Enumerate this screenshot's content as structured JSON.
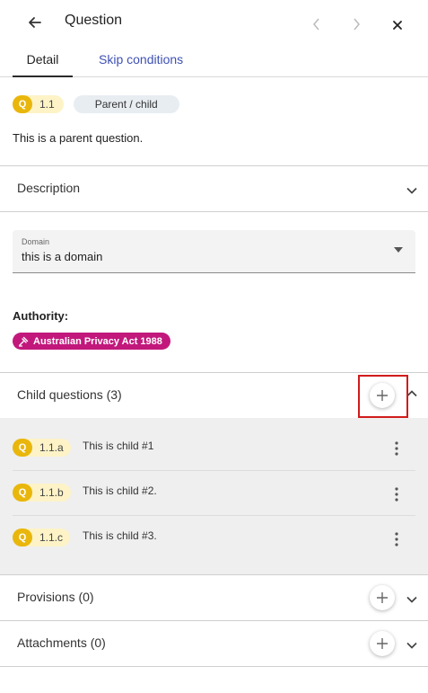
{
  "header": {
    "title": "Question"
  },
  "tabs": [
    {
      "label": "Detail"
    },
    {
      "label": "Skip conditions"
    }
  ],
  "question": {
    "badge_letter": "Q",
    "number": "1.1",
    "type": "Parent / child",
    "text": "This is a parent question."
  },
  "description": {
    "label": "Description"
  },
  "domain": {
    "label": "Domain",
    "value": "this is a domain"
  },
  "authority": {
    "label": "Authority:",
    "chip": "Australian Privacy Act 1988",
    "chip_color": "#c2187c"
  },
  "child_questions": {
    "label": "Child questions (3)",
    "items": [
      {
        "letter": "Q",
        "number": "1.1.a",
        "text": "This is child #1"
      },
      {
        "letter": "Q",
        "number": "1.1.b",
        "text": "This is child #2."
      },
      {
        "letter": "Q",
        "number": "1.1.c",
        "text": "This is child #3."
      }
    ]
  },
  "provisions": {
    "label": "Provisions (0)"
  },
  "attachments": {
    "label": "Attachments (0)"
  },
  "colors": {
    "accent": "#3f51b5",
    "badge": "#e9b60c",
    "badge_bg": "#fdf3c7",
    "highlight": "#d11b1b"
  },
  "icons": {
    "back": "arrow-left-icon",
    "prev": "chevron-left-icon",
    "next": "chevron-right-icon",
    "close": "close-icon",
    "add": "plus-icon",
    "menu": "more-vert-icon",
    "gavel": "gavel-icon"
  }
}
